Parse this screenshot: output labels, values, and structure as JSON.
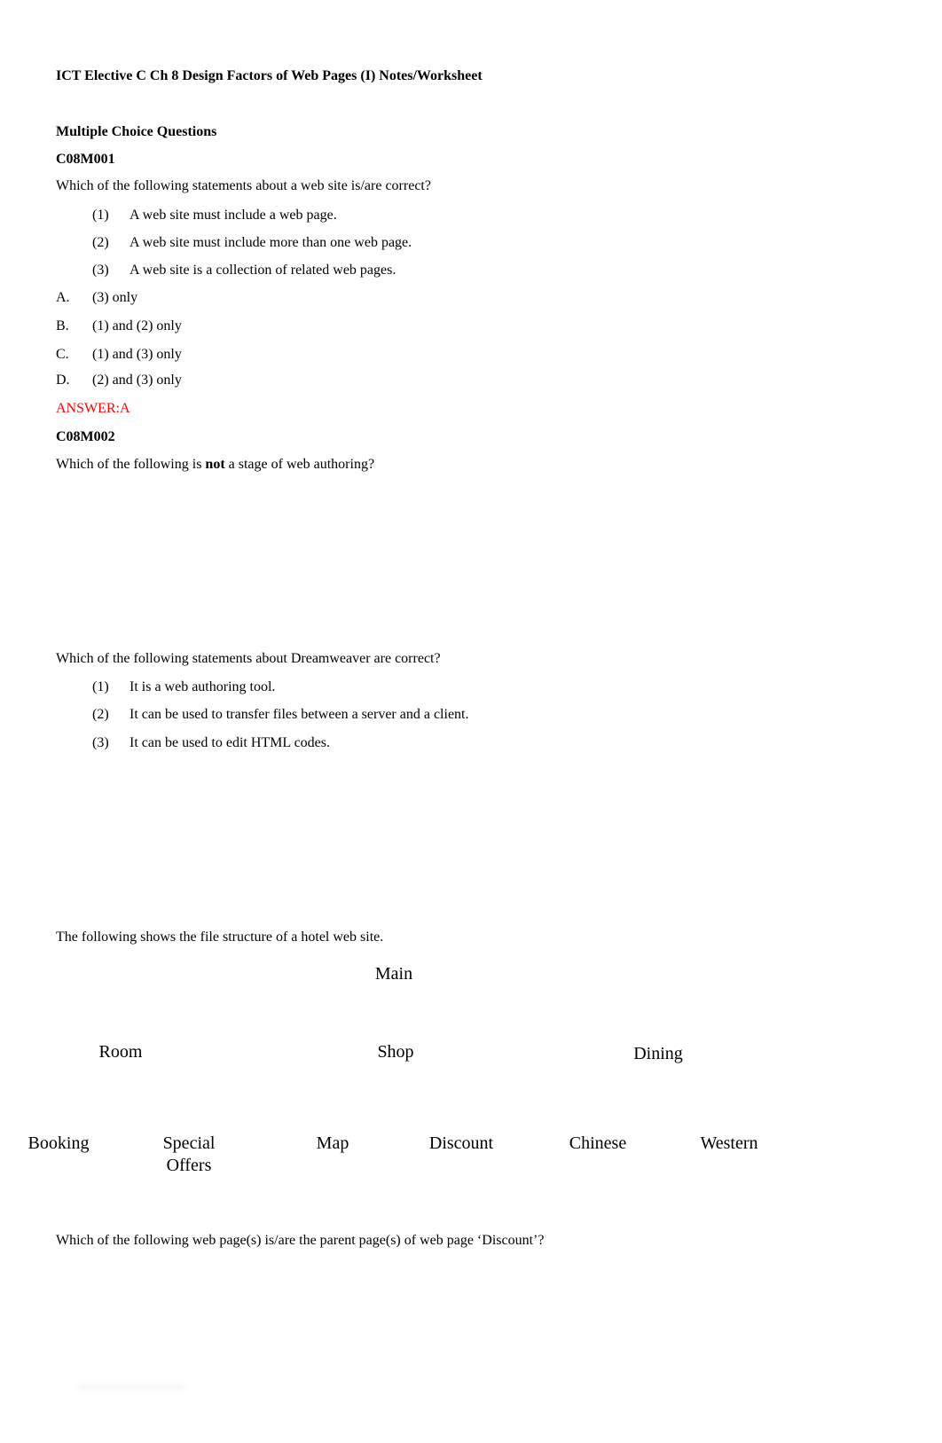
{
  "document": {
    "title": "ICT Elective C Ch 8 Design Factors of Web Pages (I) Notes/Worksheet",
    "section_heading": "Multiple Choice Questions"
  },
  "questions": [
    {
      "code": "C08M001",
      "stem": "Which of the following statements about a web site is/are correct?",
      "statements": [
        {
          "num": "(1)",
          "text": "A web site must include a web page."
        },
        {
          "num": "(2)",
          "text": "A web site must include more than one web page."
        },
        {
          "num": "(3)",
          "text": "A web site is a collection of related web pages."
        }
      ],
      "options": [
        {
          "letter": "A.",
          "text": "(3) only"
        },
        {
          "letter": "B.",
          "text": "(1) and (2) only"
        },
        {
          "letter": "C.",
          "text": "(1) and (3) only"
        },
        {
          "letter": "D.",
          "text": "(2) and (3) only"
        }
      ],
      "answer": "ANSWER:A",
      "answer_color": "#ff0000"
    },
    {
      "code": "C08M002",
      "stem_before": "Which of the following is ",
      "stem_bold": "not",
      "stem_after": " a stage of web authoring?"
    },
    {
      "stem": "Which of the following statements about Dreamweaver are correct?",
      "statements": [
        {
          "num": "(1)",
          "text": "It is a web authoring tool."
        },
        {
          "num": "(2)",
          "text": "It can be used to transfer files between a server and a client."
        },
        {
          "num": "(3)",
          "text": "It can be used to edit HTML codes."
        }
      ]
    },
    {
      "intro": "The following shows the file structure of a hotel web site.",
      "stem": "Which of the following web page(s) is/are the parent page(s) of web page ‘Discount’?"
    }
  ],
  "site_structure": {
    "root": "Main",
    "level1": [
      "Room",
      "Shop",
      "Dining"
    ],
    "level2": [
      {
        "label_line1": "Booking",
        "label_line2": "",
        "parent": "Room"
      },
      {
        "label_line1": "Special",
        "label_line2": "Offers",
        "parent": "Room"
      },
      {
        "label_line1": "Map",
        "label_line2": "",
        "parent": "Shop"
      },
      {
        "label_line1": "Discount",
        "label_line2": "",
        "parent": "Shop"
      },
      {
        "label_line1": "Chinese",
        "label_line2": "",
        "parent": "Dining"
      },
      {
        "label_line1": "Western",
        "label_line2": "",
        "parent": "Dining"
      }
    ]
  }
}
